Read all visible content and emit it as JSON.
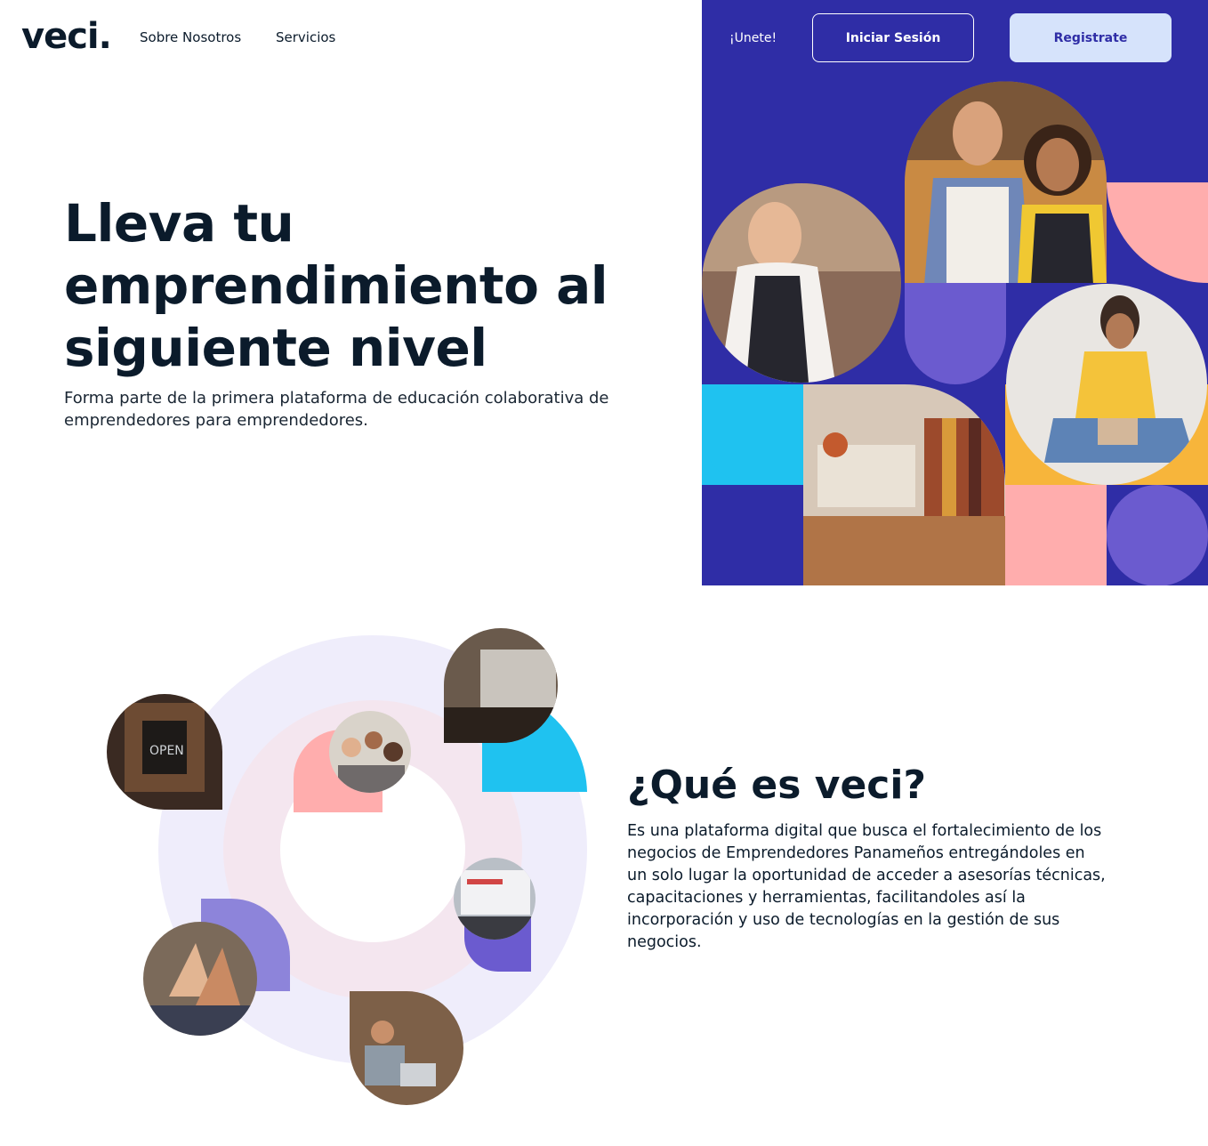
{
  "header": {
    "logo": "veci.",
    "nav": [
      "Sobre Nosotros",
      "Servicios"
    ],
    "join_text": "¡Unete!",
    "login_label": "Iniciar Sesión",
    "register_label": "Registrate"
  },
  "hero": {
    "title_lines": [
      "Lleva tu",
      "emprendimiento al",
      "siguiente nivel"
    ],
    "subtitle": "Forma parte de la primera plataforma de educación colaborativa de emprendedores para emprendedores."
  },
  "about": {
    "title": "¿Qué es veci?",
    "body": "Es una plataforma digital que busca el fortalecimiento de los negocios de Emprendedores Panameños entregándoles en un solo lugar la oportunidad de acceder a asesorías técnicas, capacitaciones y herramientas, facilitandoles así la incorporación y uso de tecnologías en la gestión de sus negocios."
  },
  "colors": {
    "dark_text": "#0b1b2b",
    "hero_bg": "#2f2da6",
    "register_bg": "#d6e3fb",
    "cyan": "#1fc2f0",
    "pink": "#ffadad",
    "purple": "#6b5bcf",
    "yellow": "#f7b53b"
  },
  "images": [
    "photo-woman-apron",
    "photo-couple-apron",
    "photo-clothing-store",
    "photo-woman-phone",
    "photo-open-sign",
    "photo-team-laptop",
    "photo-cafe-counter",
    "photo-laptop-screen",
    "photo-high-five",
    "photo-man-laptop"
  ]
}
